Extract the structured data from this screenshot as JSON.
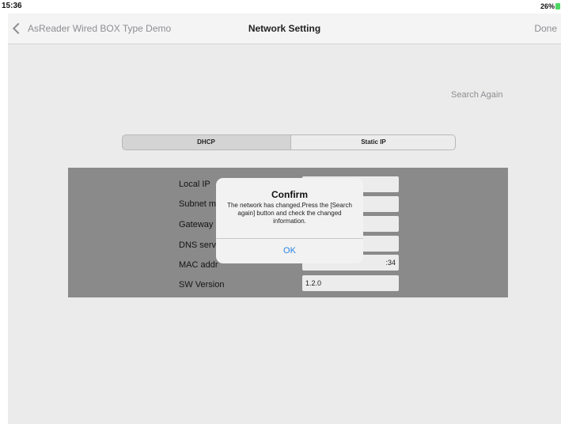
{
  "status_bar": {
    "time": "15:36",
    "battery": "26%"
  },
  "nav": {
    "back_label": "AsReader Wired BOX Type Demo",
    "title": "Network Setting",
    "done_label": "Done"
  },
  "search_again_label": "Search Again",
  "segments": {
    "dhcp": "DHCP",
    "static": "Static IP",
    "selected": "Static IP"
  },
  "settings": {
    "local_ip_label": "Local IP",
    "subnet_label": "Subnet m",
    "gateway_label": "Gateway",
    "dns_label": "DNS serv",
    "mac_label": "MAC addr",
    "mac_value": ":34",
    "sw_version_label": "SW Version",
    "sw_version_value": "1.2.0"
  },
  "alert": {
    "title": "Confirm",
    "message": "The network has changed.Press the [Search again] button and check the changed information.",
    "ok_label": "OK"
  },
  "colors": {
    "accent": "#2a82e4",
    "battery": "#4cd964",
    "overlay": "#8a8a8a"
  }
}
